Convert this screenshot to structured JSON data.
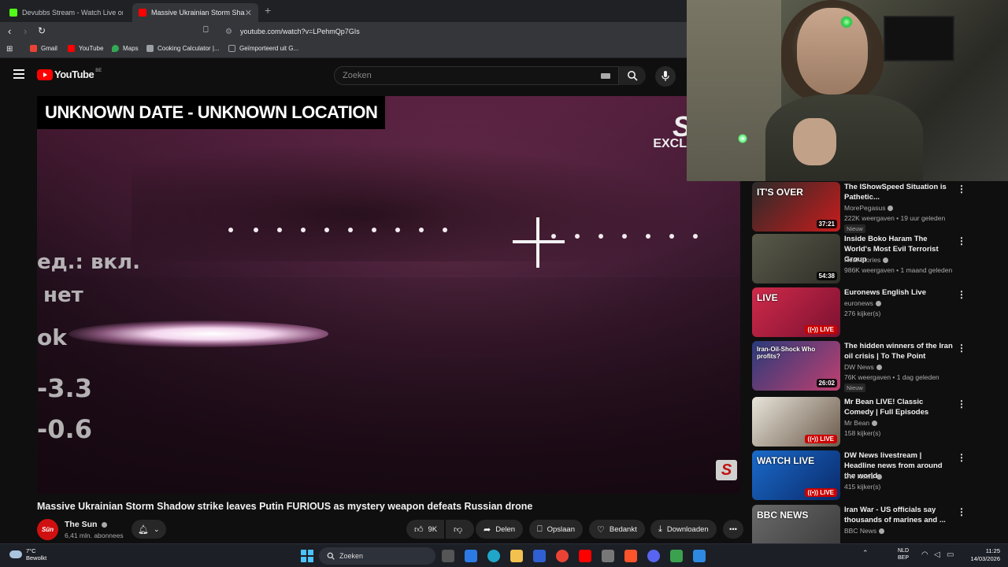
{
  "browser": {
    "tabs": [
      {
        "title": "Devubbs Stream - Watch Live on",
        "active": false,
        "favicon_color": "#53fc18"
      },
      {
        "title": "Massive Ukrainian Storm Sha",
        "active": true,
        "favicon_color": "#ff0000"
      }
    ],
    "url": "youtube.com/watch?v=LPehmQp7GIs",
    "bookmarks": [
      {
        "label": "Gmail",
        "icon": "gmail-icon",
        "color": "#ea4335"
      },
      {
        "label": "YouTube",
        "icon": "youtube-icon",
        "color": "#ff0000"
      },
      {
        "label": "Maps",
        "icon": "maps-icon",
        "color": "#34a853"
      },
      {
        "label": "Cooking Calculator |...",
        "icon": "cooking-icon",
        "color": "#9aa0a6"
      },
      {
        "label": "Geïmporteerd uit G...",
        "icon": "folder-icon",
        "color": "#9aa0a6"
      }
    ]
  },
  "masthead": {
    "logo_text": "YouTube",
    "country_code": "BE",
    "search_placeholder": "Zoeken"
  },
  "video": {
    "caption": "UNKNOWN DATE - UNKNOWN LOCATION",
    "brand_mark": "S",
    "brand_sub": "EXCL",
    "osd_lines": [
      "ед.: вкл.",
      "нет",
      "ok",
      "-3.3",
      "-0.6"
    ],
    "corner_badge": "S",
    "title": "Massive Ukrainian Storm Shadow strike leaves Putin FURIOUS as mystery weapon defeats Russian drone"
  },
  "channel": {
    "avatar_text": "Sün",
    "name": "The Sun",
    "subscribers": "6,41 mln. abonnees"
  },
  "actions": {
    "likes": "9K",
    "share": "Delen",
    "save": "Opslaan",
    "thanks": "Bedankt",
    "download": "Downloaden"
  },
  "recommendations": [
    {
      "title": "The IShowSpeed Situation is Pathetic...",
      "channel": "MorePegasus",
      "meta": "222K weergaven • 19 uur geleden",
      "badge": "Nieuw",
      "duration": "37:21",
      "live": false,
      "thumb_text": "IT'S OVER",
      "thumb_colors": [
        "#2a2a2a",
        "#c81c1c"
      ]
    },
    {
      "title": "Inside Boko Haram The World's Most Evil Terrorist Group",
      "channel": "Real Stories",
      "meta": "986K weergaven • 1 maand geleden",
      "badge": "",
      "duration": "54:38",
      "live": false,
      "thumb_text": "",
      "thumb_colors": [
        "#5a5a4a",
        "#2e2e28"
      ]
    },
    {
      "title": "Euronews English Live",
      "channel": "euronews",
      "meta": "276 kijker(s)",
      "badge": "",
      "duration": "",
      "live": true,
      "thumb_text": "LIVE",
      "thumb_colors": [
        "#d02a4a",
        "#7a1030"
      ]
    },
    {
      "title": "The hidden winners of the Iran oil crisis | To The Point",
      "channel": "DW News",
      "meta": "76K weergaven • 1 dag geleden",
      "badge": "Nieuw",
      "duration": "26:02",
      "live": false,
      "thumb_text": "Iran-Oil-Shock Who profits?",
      "thumb_colors": [
        "#2a3a7a",
        "#c04070"
      ]
    },
    {
      "title": "Mr Bean LIVE! Classic Comedy | Full Episodes",
      "channel": "Mr Bean",
      "meta": "158 kijker(s)",
      "badge": "",
      "duration": "",
      "live": true,
      "thumb_text": "",
      "thumb_colors": [
        "#e8e4da",
        "#6a5a4a"
      ]
    },
    {
      "title": "DW News livestream | Headline news from around the world",
      "channel": "DW News",
      "meta": "415 kijker(s)",
      "badge": "",
      "duration": "",
      "live": true,
      "thumb_text": "WATCH LIVE",
      "thumb_colors": [
        "#1a6aca",
        "#0a2a6a"
      ]
    },
    {
      "title": "Iran War - US officials say thousands of marines and ...",
      "channel": "BBC News",
      "meta": "",
      "badge": "",
      "duration": "",
      "live": false,
      "thumb_text": "BBC NEWS",
      "thumb_colors": [
        "#6a6a6a",
        "#3a3a3a"
      ]
    }
  ],
  "taskbar": {
    "weather_temp": "7°C",
    "weather_desc": "Bewolkt",
    "search_label": "Zoeken",
    "lang_top": "NLD",
    "lang_bottom": "BEP",
    "time": "11:25",
    "date": "14/03/2026"
  }
}
